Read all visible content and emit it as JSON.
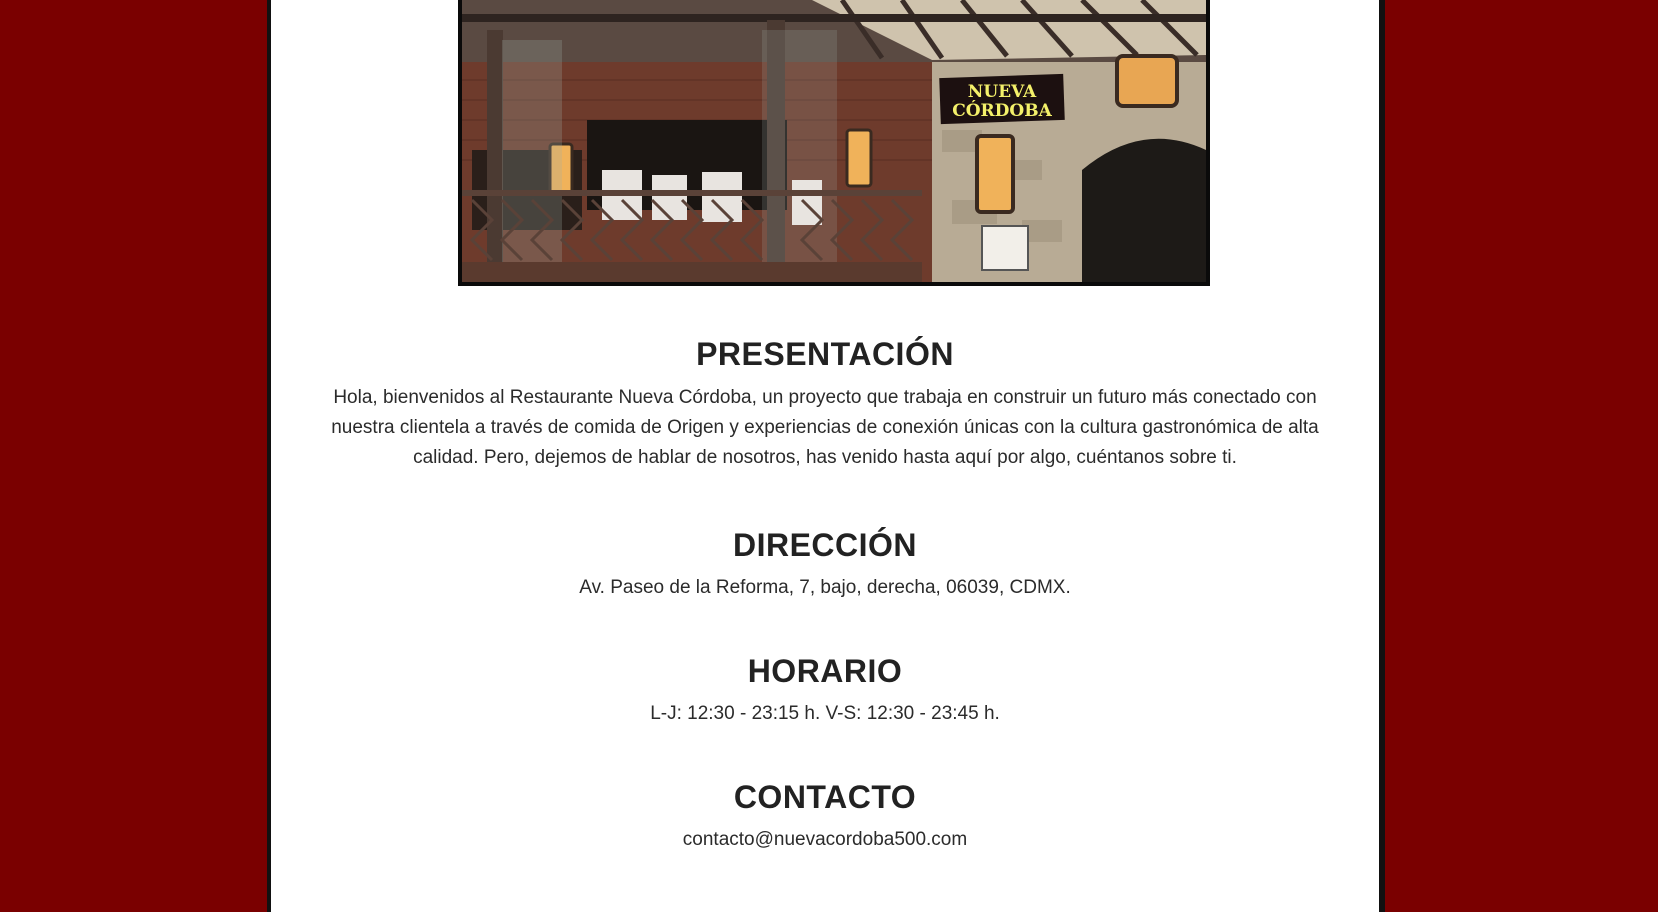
{
  "colors": {
    "background": "#7a0000",
    "content_bg": "#ffffff",
    "text": "#222222",
    "sign_text": "#f4f06a"
  },
  "hero": {
    "sign_line1": "NUEVA",
    "sign_line2": "CÓRDOBA"
  },
  "sections": {
    "presentacion": {
      "title": "PRESENTACIÓN",
      "body": "Hola, bienvenidos al Restaurante Nueva Córdoba, un proyecto que trabaja en construir un futuro más conectado con nuestra clientela a través de comida de Origen y experiencias de conexión únicas con la cultura gastronómica de alta calidad. Pero, dejemos de hablar de nosotros, has venido hasta aquí por algo, cuéntanos sobre ti."
    },
    "direccion": {
      "title": "DIRECCIÓN",
      "body": "Av. Paseo de la Reforma, 7, bajo, derecha, 06039, CDMX."
    },
    "horario": {
      "title": "HORARIO",
      "body": "L-J: 12:30 - 23:15 h. V-S: 12:30 - 23:45 h."
    },
    "contacto": {
      "title": "CONTACTO",
      "body": "contacto@nuevacordoba500.com"
    }
  }
}
